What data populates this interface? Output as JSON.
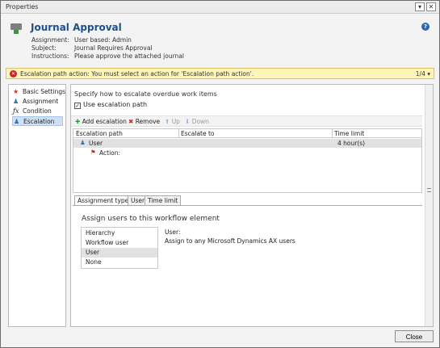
{
  "window": {
    "title": "Properties",
    "minimize_label": "▾",
    "close_label": "✕"
  },
  "header": {
    "title": "Journal Approval",
    "fields": [
      {
        "label": "Assignment:",
        "value": "User based: Admin"
      },
      {
        "label": "Subject:",
        "value": "Journal Requires Approval"
      },
      {
        "label": "Instructions:",
        "value": "Please approve the attached journal"
      }
    ],
    "help_label": "?"
  },
  "warning": {
    "icon": "error-icon",
    "text": "Escalation path action: You must select an action for 'Escalation path action'.",
    "count": "1/4 ▾"
  },
  "nav": {
    "items": [
      {
        "label": "Basic Settings",
        "icon": "star-icon"
      },
      {
        "label": "Assignment",
        "icon": "users-icon"
      },
      {
        "label": "Condition",
        "icon": "function-icon"
      },
      {
        "label": "Escalation",
        "icon": "escalation-icon"
      }
    ]
  },
  "escalation": {
    "instruction": "Specify how to escalate overdue work items",
    "use_path_label": "Use escalation path",
    "use_path_checked": true,
    "toolbar": {
      "add": "Add escalation",
      "remove": "Remove",
      "up": "Up",
      "down": "Down"
    },
    "grid": {
      "columns": [
        "Escalation path",
        "Escalate to",
        "Time limit"
      ],
      "rows": [
        {
          "path": "User",
          "escalate_to": "",
          "time_limit": "4 hour(s)"
        },
        {
          "path": "Action:",
          "escalate_to": "",
          "time_limit": ""
        }
      ]
    }
  },
  "tabs": [
    {
      "label": "Assignment type",
      "active": true
    },
    {
      "label": "User",
      "active": false
    },
    {
      "label": "Time limit",
      "active": false
    }
  ],
  "assignment_panel": {
    "title": "Assign users to this workflow element",
    "options": [
      "Hierarchy",
      "Workflow user",
      "User",
      "None"
    ],
    "selected_option": "User",
    "description_title": "User:",
    "description_text": "Assign to any Microsoft Dynamics AX users"
  },
  "footer": {
    "close_label": "Close"
  }
}
